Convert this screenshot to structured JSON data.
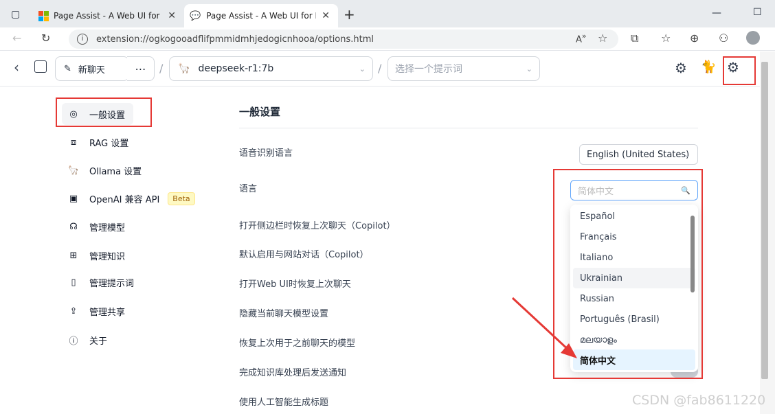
{
  "browser": {
    "tabs": [
      {
        "label": "Page Assist - A Web UI for Local"
      },
      {
        "label": "Page Assist - A Web UI for Local"
      }
    ],
    "url": "extension://ogkogooadflifpmmidmhjedogicnhooa/options.html"
  },
  "header": {
    "new_chat": "新聊天",
    "model": "deepseek-r1:7b",
    "prompt_placeholder": "选择一个提示词"
  },
  "sidebar": {
    "items": [
      {
        "label": "一般设置"
      },
      {
        "label": "RAG 设置"
      },
      {
        "label": "Ollama 设置"
      },
      {
        "label": "OpenAI 兼容 API",
        "badge": "Beta"
      },
      {
        "label": "管理模型"
      },
      {
        "label": "管理知识"
      },
      {
        "label": "管理提示词"
      },
      {
        "label": "管理共享"
      },
      {
        "label": "关于"
      }
    ]
  },
  "main": {
    "title": "一般设置",
    "settings": [
      {
        "label": "语音识别语言"
      },
      {
        "label": "语言"
      },
      {
        "label": "打开侧边栏时恢复上次聊天（Copilot）"
      },
      {
        "label": "默认启用与网站对话（Copilot）"
      },
      {
        "label": "打开Web UI时恢复上次聊天"
      },
      {
        "label": "隐藏当前聊天模型设置"
      },
      {
        "label": "恢复上次用于之前聊天的模型"
      },
      {
        "label": "完成知识库处理后发送通知"
      },
      {
        "label": "使用人工智能生成标题"
      }
    ],
    "speech_language_value": "English (United States)",
    "language_search_placeholder": "简体中文",
    "language_options": [
      "Español",
      "Français",
      "Italiano",
      "Ukrainian",
      "Russian",
      "Português (Brasil)",
      "മലയാളം",
      "简体中文"
    ],
    "language_selected": "简体中文",
    "language_hovered": "Ukrainian"
  },
  "watermark": "CSDN @fab8611220",
  "colors": {
    "annotation_red": "#e53935",
    "selected_option_bg": "#e6f4ff",
    "focus_border": "#60a5fa"
  }
}
